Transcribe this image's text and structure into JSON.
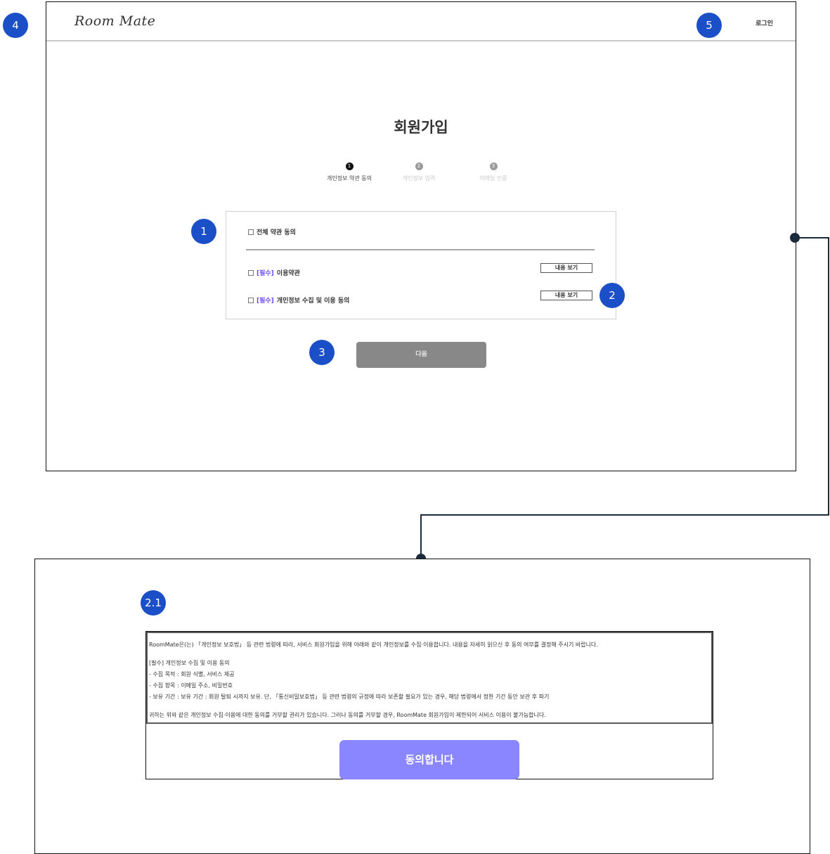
{
  "markers": {
    "m1": "1",
    "m2": "2",
    "m3": "3",
    "m4": "4",
    "m5": "5",
    "m21": "2.1"
  },
  "header": {
    "logo": "Room Mate",
    "login": "로그인"
  },
  "page_title": "회원가입",
  "steps": [
    {
      "num": "1",
      "label": "개인정보 약관 동의",
      "active": true
    },
    {
      "num": "2",
      "label": "개인정보 입력",
      "active": false
    },
    {
      "num": "3",
      "label": "이메일 인증",
      "active": false
    }
  ],
  "terms": {
    "all_agree": "전체 약관 동의",
    "required_tag": "[필수]",
    "terms_of_use": "이용약관",
    "privacy_consent": "개인정보 수집 및 이용 동의",
    "view_button": "내용 보기"
  },
  "next_button": "다음",
  "modal": {
    "intro": "RoomMate은(는) 「개인정보 보호법」 등 관련 법령에 따라, 서비스 회원가입을 위해 아래와 같이 개인정보를 수집·이용합니다. 내용을 자세히 읽으신 후 동의 여부를 결정해 주시기 바랍니다.",
    "heading": "[필수] 개인정보 수집 및 이용 동의",
    "purpose": "- 수집 목적 : 회원 식별, 서비스 제공",
    "items": "- 수집 항목 : 이메일 주소, 비밀번호",
    "retention": "- 보유 기간 : 보유 기간 : 회원 탈퇴 시까지 보유. 단, 「통신비밀보호법」 등 관련 법령의 규정에 따라 보존할 필요가 있는 경우, 해당 법령에서 정한 기간 동안 보관 후 파기",
    "notice": "귀하는 위와 같은 개인정보 수집·이용에 대한 동의를 거부할 권리가 있습니다. 그러나 동의를 거부할 경우, RoomMate 회원가입이 제한되어 서비스 이용이 불가능합니다.",
    "agree_button": "동의합니다"
  },
  "colors": {
    "marker": "#1b4fc7",
    "required": "#6b4dff",
    "agree": "#8a86ff",
    "next": "#888888"
  }
}
